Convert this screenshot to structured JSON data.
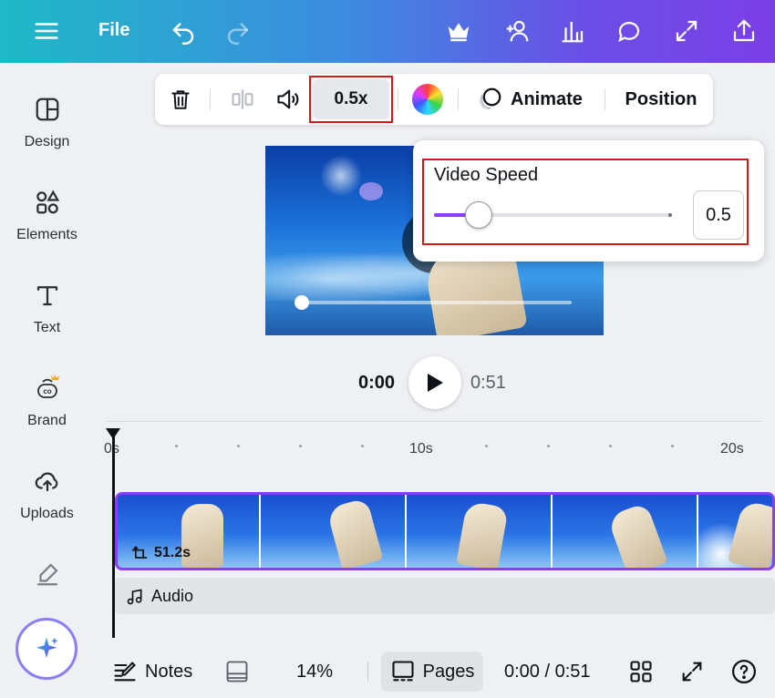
{
  "header": {
    "file_label": "File",
    "icons": [
      "menu-icon",
      "undo-icon",
      "redo-icon",
      "crown-icon",
      "share-people-icon",
      "insights-icon",
      "comment-icon",
      "fullscreen-icon",
      "export-icon"
    ]
  },
  "sidebar": {
    "items": [
      {
        "label": "Design",
        "icon": "design-icon"
      },
      {
        "label": "Elements",
        "icon": "elements-icon"
      },
      {
        "label": "Text",
        "icon": "text-icon"
      },
      {
        "label": "Brand",
        "icon": "brand-icon"
      },
      {
        "label": "Uploads",
        "icon": "uploads-icon"
      },
      {
        "label": "",
        "icon": "draw-icon"
      }
    ],
    "magic_icon": "sparkle-icon"
  },
  "toolbar": {
    "speed_label": "0.5x",
    "animate_label": "Animate",
    "position_label": "Position"
  },
  "speed_popover": {
    "title": "Video Speed",
    "value": "0.5",
    "slider_fraction": 0.19
  },
  "playback": {
    "current_time": "0:00",
    "total_time": "0:51"
  },
  "timeline": {
    "ruler": [
      "0s",
      "10s",
      "20s"
    ],
    "clip_duration": "51.2s",
    "audio_label": "Audio"
  },
  "footer": {
    "notes_label": "Notes",
    "zoom": "14%",
    "pages_label": "Pages",
    "time": "0:00 / 0:51"
  },
  "colors": {
    "accent": "#8b3dff",
    "highlight": "#d01a1a"
  }
}
